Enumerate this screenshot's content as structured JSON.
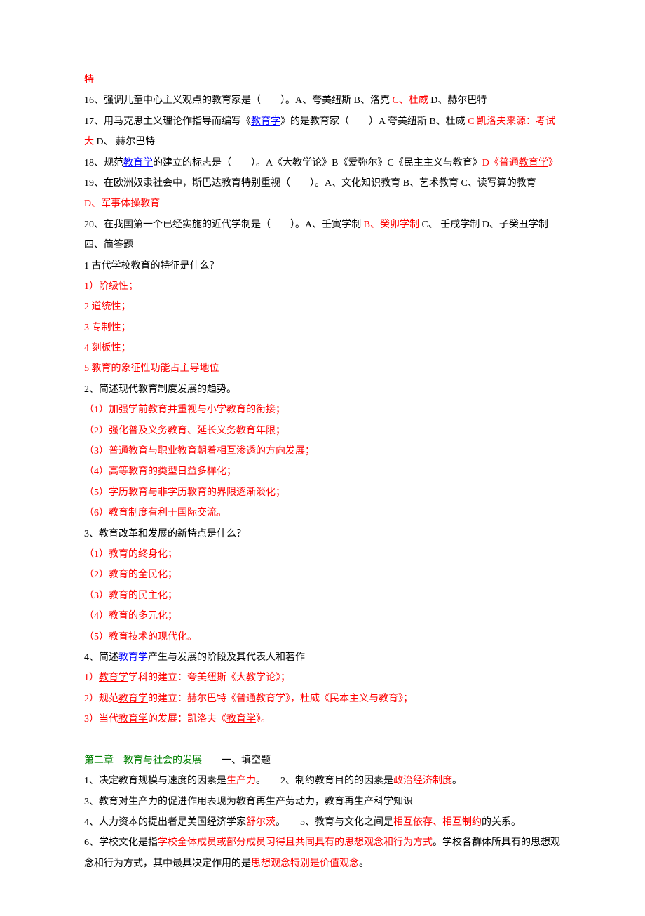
{
  "lines": {
    "l0": "特",
    "l1a": "16、强调儿童中心主义观点的教育家是（　　）。A、夸美纽斯 B、洛克 ",
    "l1b": "C、杜威 ",
    "l1c": "D、赫尔巴特",
    "l2a": "17、用马克思主义理论作指导而编写《",
    "l2link": "教育学",
    "l2b": "》的是教育家（　　）A 夸美纽斯 B、杜威 ",
    "l2c": "C 凯洛夫来源：考试大 ",
    "l2d": "D、 赫尔巴特",
    "l3a": "18、规范",
    "l3link": "教育学",
    "l3b": "的建立的标志是（　　）。A《大教学论》B《爱弥尔》C《民主主义与教育》",
    "l3c": "D《普通",
    "l3link2": "教育学",
    "l3d": "》",
    "l4a": "19、在欧洲奴隶社会中，斯巴达教育特别重视（　　）。A、文化知识教育 B、艺术教育 C、读写算的教育",
    "l4b": "D、军事体操教育",
    "l5a": "20、在我国第一个已经实施的近代学制是（　　）。A、壬寅学制 ",
    "l5b": "B、癸卯学制 ",
    "l5c": "C、 壬戌学制 D、子癸丑学制",
    "l6": "四、简答题",
    "l7": "1 古代学校教育的特征是什么？",
    "l8": "1）阶级性；",
    "l9": "2 道统性；",
    "l10": "3 专制性；",
    "l11": "4 刻板性；",
    "l12": "5 教育的象征性功能占主导地位",
    "l13": "2、简述现代教育制度发展的趋势。",
    "l14": "（1）加强学前教育并重视与小学教育的衔接；",
    "l15": "（2）强化普及义务教育、延长义务教育年限；",
    "l16": "（3）普通教育与职业教育朝着相互渗透的方向发展；",
    "l17": "（4）高等教育的类型日益多样化；",
    "l18": "（5）学历教育与非学历教育的界限逐渐淡化；",
    "l19": "（6）教育制度有利于国际交流。",
    "l20": "3、教育改革和发展的新特点是什么？",
    "l21": "（1）教育的终身化；",
    "l22": "（2）教育的全民化；",
    "l23": "（3）教育的民主化；",
    "l24": "（4）教育的多元化；",
    "l25": "（5）教育技术的现代化。",
    "l26a": "4、简述",
    "l26link": "教育学",
    "l26b": "产生与发展的阶段及其代表人和著作",
    "l27a": "1）",
    "l27link": "教育学",
    "l27b": "学科的建立：夸美纽斯《大教学论》；",
    "l28a": "2）规范",
    "l28link": "教育学",
    "l28b": "的建立：赫尔巴特《普通教育学》，杜威《民本主义与教育》；",
    "l29a": "3）当代",
    "l29link": "教育学",
    "l29b": "的发展：凯洛夫《",
    "l29link2": "教育学",
    "l29c": "》。",
    "l30a": "第二章　教育与社会的发展",
    "l30b": "　　一、填空题",
    "l31a": "1、决定教育规模与速度的因素是",
    "l31b": "生产力",
    "l31c": "。　　2、制约教育目的的因素是",
    "l31d": "政治经济制度",
    "l31e": "。",
    "l32": "3、教育对生产力的促进作用表现为教育再生产劳动力，教育再生产科学知识",
    "l33a": "4、人力资本的提出者是美国经济学家",
    "l33b": "舒尔茨",
    "l33c": "。　　5、教育与文化之间是",
    "l33d": "相互依存、相互制约",
    "l33e": "的关系。",
    "l34a": "6、学校文化是指",
    "l34b": "学校全体成员或部分成员习得且共同具有的思想观念和行为方式",
    "l34c": "。学校各群体所具有的思想观念和行为方式，其中最具决定作用的是",
    "l34d": "思想观念特别是价值观念",
    "l34e": "。"
  }
}
